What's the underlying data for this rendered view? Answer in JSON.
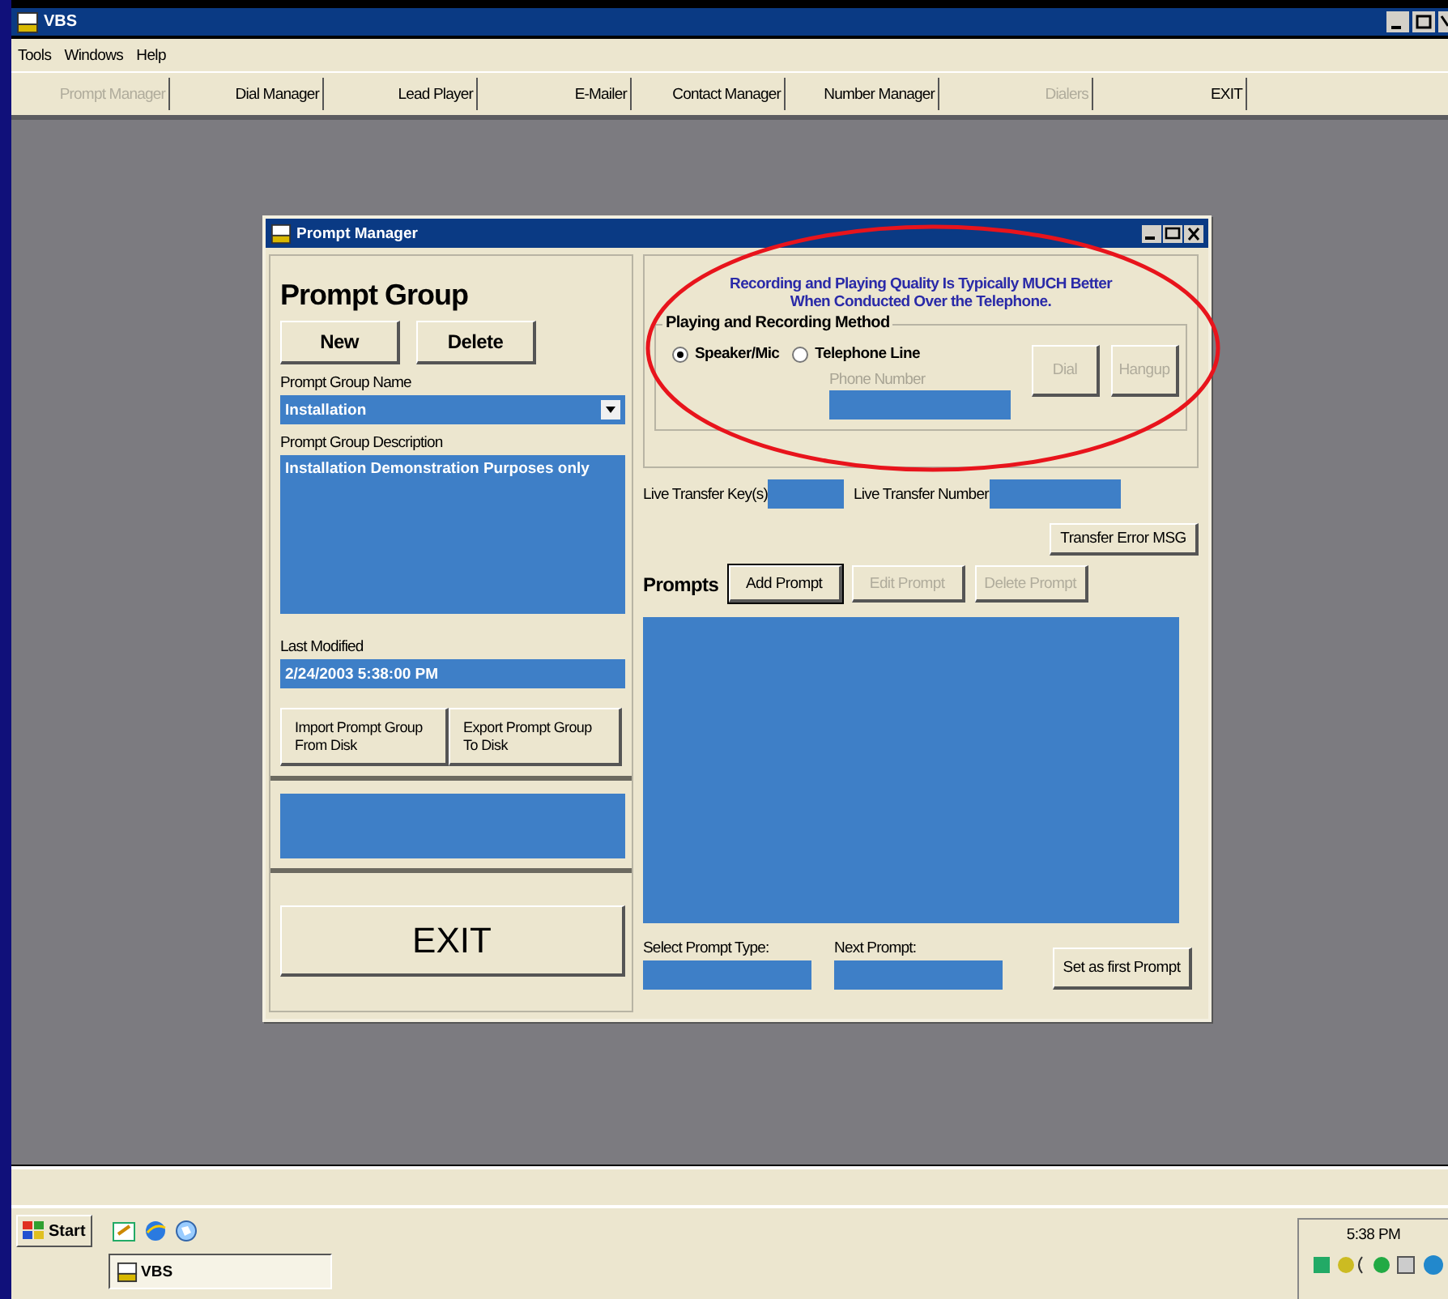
{
  "app": {
    "title": "VBS",
    "menu": [
      "Tools",
      "Windows",
      "Help"
    ],
    "toolbar": [
      {
        "label": "Prompt Manager",
        "disabled": true
      },
      {
        "label": "Dial Manager",
        "disabled": false
      },
      {
        "label": "Lead Player",
        "disabled": false
      },
      {
        "label": "E-Mailer",
        "disabled": false
      },
      {
        "label": "Contact Manager",
        "disabled": false
      },
      {
        "label": "Number Manager",
        "disabled": false
      },
      {
        "label": "Dialers",
        "disabled": true
      },
      {
        "label": "EXIT",
        "disabled": false
      }
    ]
  },
  "dialog": {
    "title": "Prompt Manager",
    "prompt_group": {
      "heading": "Prompt Group",
      "buttons": [
        "New",
        "Delete"
      ],
      "name_label": "Prompt Group Name",
      "name_value": "Installation",
      "description_label": "Prompt Group Description",
      "description_value": "Installation Demonstration Purposes only",
      "last_modified_label": "Last Modified",
      "last_modified_value": "2/24/2003 5:38:00 PM",
      "import_button": [
        "Import Prompt Group",
        "From Disk"
      ],
      "export_button": [
        "Export Prompt Group",
        "To Disk"
      ],
      "exit_button": "EXIT"
    },
    "notice": [
      "Recording and Playing Quality Is Typically MUCH Better",
      "When Conducted Over the Telephone."
    ],
    "method": {
      "legend": "Playing and Recording Method",
      "options": [
        {
          "label": "Speaker/Mic",
          "selected": true
        },
        {
          "label": "Telephone Line",
          "selected": false
        }
      ],
      "phone_label": "Phone Number",
      "dial": {
        "label": "Dial",
        "disabled": true
      },
      "hangup": {
        "label": "Hangup",
        "disabled": true
      }
    },
    "live_transfer_keys_label": "Live Transfer Key(s)",
    "live_transfer_number_label": "Live Transfer Number",
    "transfer_error_button": "Transfer Error MSG",
    "prompts_label": "Prompts",
    "prompt_buttons": [
      {
        "label": "Add Prompt",
        "disabled": false
      },
      {
        "label": "Edit Prompt",
        "disabled": true
      },
      {
        "label": "Delete Prompt",
        "disabled": true
      }
    ],
    "select_prompt_type_label": "Select Prompt Type:",
    "next_prompt_label": "Next Prompt:",
    "set_first_button": "Set as first Prompt"
  },
  "taskbar": {
    "start": "Start",
    "task": "VBS",
    "clock": "5:38 PM"
  }
}
